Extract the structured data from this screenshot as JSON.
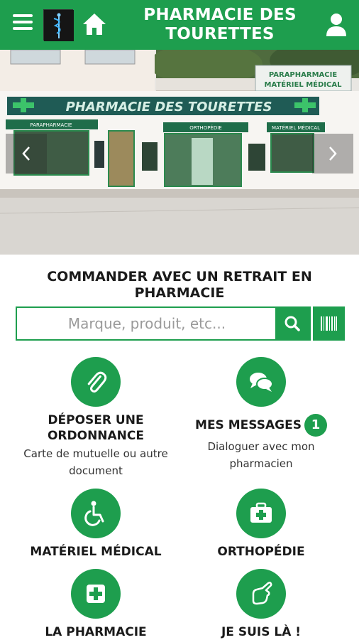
{
  "header": {
    "title": "PHARMACIE DES TOURETTES",
    "menu_icon": "hamburger-menu-icon",
    "home_icon": "home-icon",
    "user_icon": "user-icon"
  },
  "hero": {
    "sign_main": "PHARMACIE DES TOURETTES",
    "sign_side_1": "PARAPHARMACIE",
    "sign_side_2": "MATÉRIEL MÉDICAL",
    "awning_left": "PARAPHARMACIE",
    "awning_center": "ORTHOPÉDIE",
    "awning_right": "MATÉRIEL MÉDICAL"
  },
  "order": {
    "title": "COMMANDER AVEC UN RETRAIT EN PHARMACIE",
    "search_placeholder": "Marque, produit, etc..."
  },
  "tiles": {
    "prescription": {
      "title": "DÉPOSER UNE ORDONNANCE",
      "subtitle": "Carte de mutuelle ou autre document",
      "icon": "paperclip-icon"
    },
    "messages": {
      "title": "MES MESSAGES",
      "badge": "1",
      "subtitle": "Dialoguer avec mon pharmacien",
      "icon": "chat-bubbles-icon"
    },
    "medical": {
      "title": "MATÉRIEL MÉDICAL",
      "icon": "wheelchair-icon"
    },
    "ortho": {
      "title": "ORTHOPÉDIE",
      "icon": "first-aid-kit-icon"
    },
    "pharmacy": {
      "title": "LA PHARMACIE",
      "icon": "pharmacy-cross-icon"
    },
    "here": {
      "title": "JE SUIS LÀ !",
      "icon": "hand-pointing-icon"
    }
  },
  "colors": {
    "brand_green": "#1e9e4e"
  }
}
